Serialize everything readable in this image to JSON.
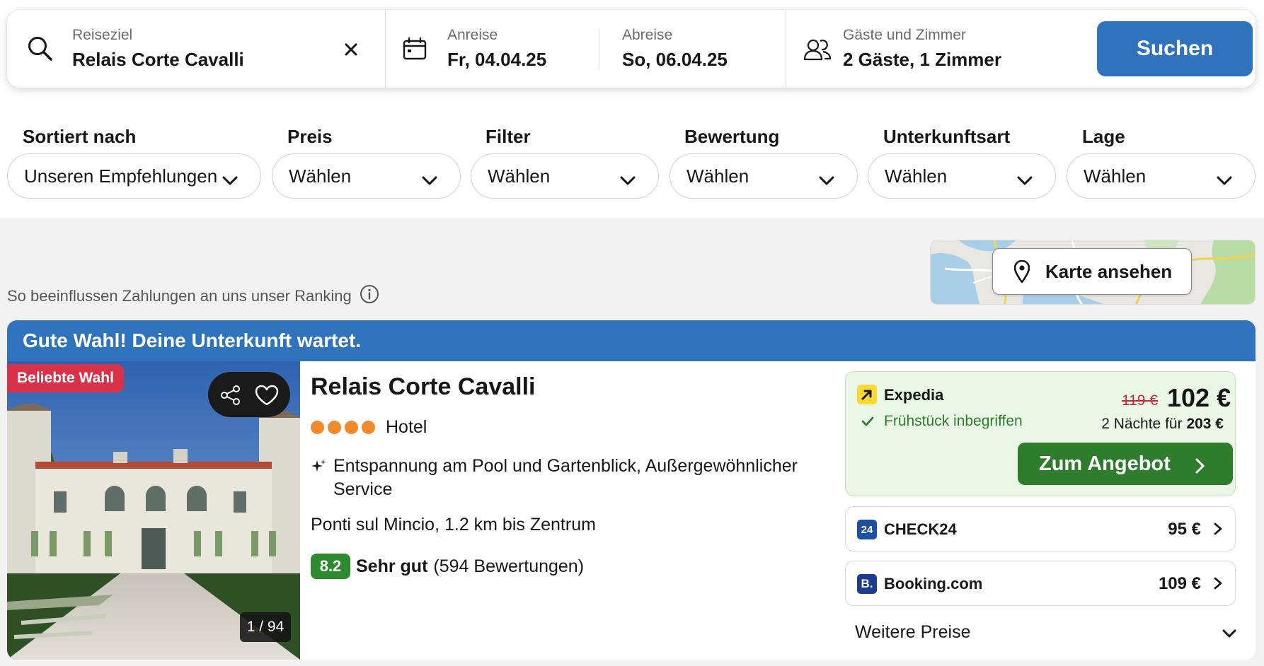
{
  "search": {
    "destination_label": "Reiseziel",
    "destination_value": "Relais Corte Cavalli",
    "checkin_label": "Anreise",
    "checkin_value": "Fr, 04.04.25",
    "checkout_label": "Abreise",
    "checkout_value": "So, 06.04.25",
    "guests_label": "Gäste und Zimmer",
    "guests_value": "2 Gäste, 1 Zimmer",
    "search_button": "Suchen"
  },
  "filters": [
    {
      "label": "Sortiert nach",
      "value": "Unseren Empfehlungen"
    },
    {
      "label": "Preis",
      "value": "Wählen"
    },
    {
      "label": "Filter",
      "value": "Wählen"
    },
    {
      "label": "Bewertung",
      "value": "Wählen"
    },
    {
      "label": "Unterkunftsart",
      "value": "Wählen"
    },
    {
      "label": "Lage",
      "value": "Wählen"
    }
  ],
  "ranking_note": "So beeinflussen Zahlungen an uns unser Ranking",
  "map_button": "Karte ansehen",
  "listing": {
    "banner": "Gute Wahl! Deine Unterkunft wartet.",
    "badge": "Beliebte Wahl",
    "photo_counter": "1 / 94",
    "name": "Relais Corte Cavalli",
    "stars": 4,
    "type": "Hotel",
    "highlights": "Entspannung am Pool und Gartenblick, Außergewöhnlicher Service",
    "location": "Ponti sul Mincio, 1.2 km bis Zentrum",
    "rating_score": "8.2",
    "rating_text": "Sehr gut",
    "rating_count": "(594 Bewertungen)",
    "featured_deal": {
      "provider": "Expedia",
      "perk": "Frühstück inbegriffen",
      "old_price": "119 €",
      "price": "102 €",
      "total_prefix": "2 Nächte für",
      "total": "203 €",
      "button": "Zum Angebot"
    },
    "other_deals": [
      {
        "provider": "CHECK24",
        "price": "95 €"
      },
      {
        "provider": "Booking.com",
        "price": "109 €"
      }
    ],
    "more_prices": "Weitere Preise"
  },
  "colors": {
    "primary_blue": "#2f73bd",
    "offer_green": "#2d7d2c",
    "rating_green": "#2d8a2e",
    "star_orange": "#f0882c",
    "badge_red": "#d8324a",
    "deal_bg": "#eaf6e6"
  }
}
